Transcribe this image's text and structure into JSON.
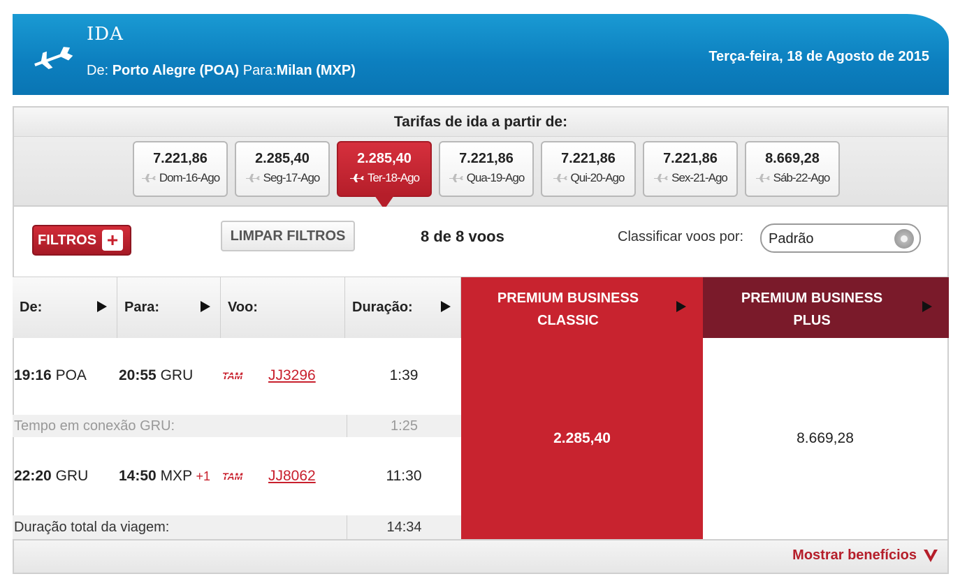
{
  "header": {
    "title": "IDA",
    "from_label": "De:",
    "from_value": "Porto Alegre (POA)",
    "to_label": "Para:",
    "to_value": "Milan (MXP)",
    "date": "Terça-feira, 18 de Agosto de 2015",
    "icon": "airplane-icon"
  },
  "fares": {
    "title": "Tarifas de ida a partir de:",
    "days": [
      {
        "price": "7.221,86",
        "label": "Dom-16-Ago",
        "active": false
      },
      {
        "price": "2.285,40",
        "label": "Seg-17-Ago",
        "active": false
      },
      {
        "price": "2.285,40",
        "label": "Ter-18-Ago",
        "active": true
      },
      {
        "price": "7.221,86",
        "label": "Qua-19-Ago",
        "active": false
      },
      {
        "price": "7.221,86",
        "label": "Qui-20-Ago",
        "active": false
      },
      {
        "price": "7.221,86",
        "label": "Sex-21-Ago",
        "active": false
      },
      {
        "price": "8.669,28",
        "label": "Sáb-22-Ago",
        "active": false
      }
    ]
  },
  "filters": {
    "filtros_label": "FILTROS",
    "limpar_label": "LIMPAR FILTROS",
    "count": "8 de 8 voos",
    "sort_label": "Classificar voos por:",
    "sort_value": "Padrão"
  },
  "table": {
    "headers": {
      "from": "De:",
      "to": "Para:",
      "flight": "Voo:",
      "duration": "Duração:",
      "classic_line1": "PREMIUM BUSINESS",
      "classic_line2": "CLASSIC",
      "plus_line1": "PREMIUM BUSINESS",
      "plus_line2": "PLUS"
    },
    "legs": [
      {
        "dep_time": "19:16",
        "dep_airport": "POA",
        "arr_time": "20:55",
        "arr_airport": "GRU",
        "next_day": "",
        "airline": "TAM",
        "flight": "JJ3296",
        "duration": "1:39"
      },
      {
        "dep_time": "22:20",
        "dep_airport": "GRU",
        "arr_time": "14:50",
        "arr_airport": "MXP",
        "next_day": "+1",
        "airline": "TAM",
        "flight": "JJ8062",
        "duration": "11:30"
      }
    ],
    "connection": {
      "label": "Tempo em conexão GRU:",
      "duration": "1:25"
    },
    "total": {
      "label": "Duração total da viagem:",
      "duration": "14:34"
    },
    "price_classic": "2.285,40",
    "price_plus": "8.669,28"
  },
  "footer": {
    "benefits_label": "Mostrar benefícios"
  },
  "colors": {
    "header_blue": "#0c7fbf",
    "accent_red": "#c8232f",
    "dark_red": "#7a1a2a"
  }
}
